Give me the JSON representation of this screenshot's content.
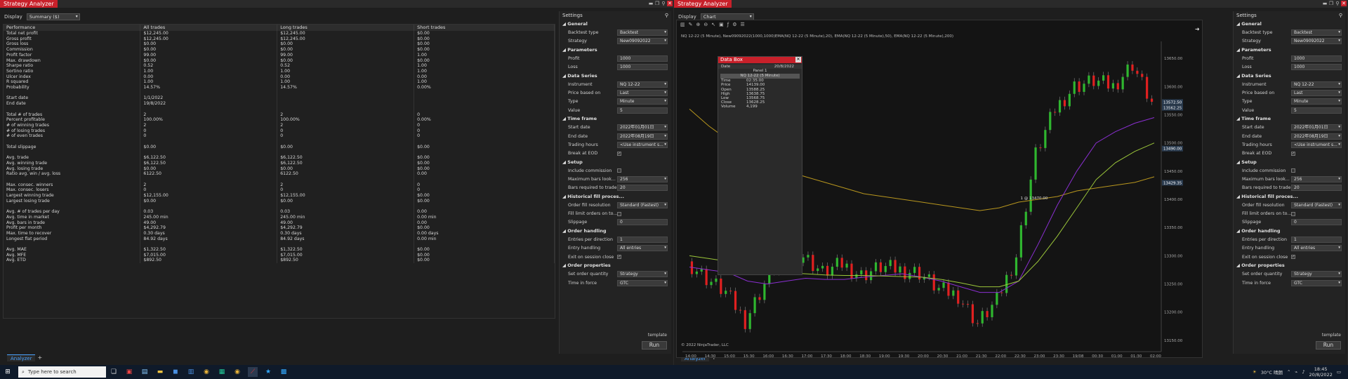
{
  "left": {
    "title": "Strategy Analyzer",
    "display_label": "Display",
    "display_value": "Summary ($)",
    "columns": [
      "Performance",
      "All trades",
      "Long trades",
      "Short trades"
    ],
    "rows": [
      [
        "Total net profit",
        "$12,245.00",
        "$12,245.00",
        "$0.00"
      ],
      [
        "Gross profit",
        "$12,245.00",
        "$12,245.00",
        "$0.00"
      ],
      [
        "Gross loss",
        "$0.00",
        "$0.00",
        "$0.00"
      ],
      [
        "Commission",
        "$0.00",
        "$0.00",
        "$0.00"
      ],
      [
        "Profit factor",
        "99.00",
        "99.00",
        "1.00"
      ],
      [
        "Max. drawdown",
        "$0.00",
        "$0.00",
        "$0.00"
      ],
      [
        "Sharpe ratio",
        "0.52",
        "0.52",
        "1.00"
      ],
      [
        "Sortino ratio",
        "1.00",
        "1.00",
        "1.00"
      ],
      [
        "Ulcer index",
        "0.00",
        "0.00",
        "0.00"
      ],
      [
        "R squared",
        "1.00",
        "1.00",
        "1.00"
      ],
      [
        "Probability",
        "14.57%",
        "14.57%",
        "0.00%"
      ],
      [
        "",
        "",
        "",
        ""
      ],
      [
        "Start date",
        "1/1/2022",
        "",
        ""
      ],
      [
        "End date",
        "19/8/2022",
        "",
        ""
      ],
      [
        "",
        "",
        "",
        ""
      ],
      [
        "Total # of trades",
        "2",
        "2",
        "0"
      ],
      [
        "Percent profitable",
        "100.00%",
        "100.00%",
        "0.00%"
      ],
      [
        "# of winning trades",
        "2",
        "2",
        "0"
      ],
      [
        "# of losing trades",
        "0",
        "0",
        "0"
      ],
      [
        "# of even trades",
        "0",
        "0",
        "0"
      ],
      [
        "",
        "",
        "",
        ""
      ],
      [
        "Total slippage",
        "$0.00",
        "$0.00",
        "$0.00"
      ],
      [
        "",
        "",
        "",
        ""
      ],
      [
        "Avg. trade",
        "$6,122.50",
        "$6,122.50",
        "$0.00"
      ],
      [
        "Avg. winning trade",
        "$6,122.50",
        "$6,122.50",
        "$0.00"
      ],
      [
        "Avg. losing trade",
        "$0.00",
        "$0.00",
        "$0.00"
      ],
      [
        "Ratio avg. win / avg. loss",
        "6122.50",
        "6122.50",
        "0.00"
      ],
      [
        "",
        "",
        "",
        ""
      ],
      [
        "Max. consec. winners",
        "2",
        "2",
        "0"
      ],
      [
        "Max. consec. losers",
        "0",
        "0",
        "0"
      ],
      [
        "Largest winning trade",
        "$12,155.00",
        "$12,155.00",
        "$0.00"
      ],
      [
        "Largest losing trade",
        "$0.00",
        "$0.00",
        "$0.00"
      ],
      [
        "",
        "",
        "",
        ""
      ],
      [
        "Avg. # of trades per day",
        "0.03",
        "0.03",
        "0.00"
      ],
      [
        "Avg. time in market",
        "245.00 min",
        "245.00 min",
        "0.00 min"
      ],
      [
        "Avg. bars in trade",
        "49.00",
        "49.00",
        "0.00"
      ],
      [
        "Profit per month",
        "$4,292.79",
        "$4,292.79",
        "$0.00"
      ],
      [
        "Max. time to recover",
        "0.30 days",
        "0.30 days",
        "0.00 days"
      ],
      [
        "Longest flat period",
        "84.92 days",
        "84.92 days",
        "0.00 min"
      ],
      [
        "",
        "",
        "",
        ""
      ],
      [
        "Avg. MAE",
        "$1,322.50",
        "$1,322.50",
        "$0.00"
      ],
      [
        "Avg. MFE",
        "$7,015.00",
        "$7,015.00",
        "$0.00"
      ],
      [
        "Avg. ETD",
        "$892.50",
        "$892.50",
        "$0.00"
      ]
    ],
    "tab": "Analyzer"
  },
  "right": {
    "title": "Strategy Analyzer",
    "display_label": "Display",
    "display_value": "Chart",
    "tab": "Analyzer",
    "series_label": "NQ 12-22 (5 Minute), New09092022(1000,1000)EMA(NQ 12-22 (5 Minute),20), EMA(NQ 12-22 (5 Minute),50), EMA(NQ 12-22 (5 Minute),200)",
    "copyright": "© 2022 NinjaTrader, LLC",
    "time_labels": [
      "14:00",
      "14:30",
      "15:00",
      "15:30",
      "16:00",
      "16:30",
      "17:00",
      "17:30",
      "18:00",
      "18:30",
      "19:00",
      "19:30",
      "20:00",
      "20:30",
      "21:00",
      "21:30",
      "22:00",
      "22:30",
      "23:00",
      "23:30",
      "19/08",
      "00:30",
      "01:00",
      "01:30",
      "02:00"
    ],
    "price_labels": [
      "13650.00",
      "13600.00",
      "13550.00",
      "13500.00",
      "13450.00",
      "13400.00",
      "13350.00",
      "13300.00",
      "13250.00",
      "13200.00",
      "13150.00"
    ],
    "price_markers": [
      "13572.50",
      "13562.25",
      "13490.00",
      "13429.35"
    ],
    "trade_label": "1 @ 13470.00",
    "databox": {
      "title": "Data Box",
      "date_label": "Date",
      "date_value": "20/8/2022",
      "panel": "Panel 1",
      "series": "NQ 12-22 (5 Minute)",
      "rows": [
        [
          "Time",
          "02:35:00"
        ],
        [
          "Price",
          "14139.00"
        ],
        [
          "Open",
          "13588.25"
        ],
        [
          "High",
          "13638.75"
        ],
        [
          "Low",
          "13568.75"
        ],
        [
          "Close",
          "13628.25"
        ],
        [
          "Volume",
          "4,199"
        ]
      ]
    }
  },
  "settings": {
    "header": "Settings",
    "sections": [
      {
        "name": "General",
        "rows": [
          [
            "Backtest type",
            "Backtest",
            "select"
          ],
          [
            "Strategy",
            "New09092022",
            "select"
          ]
        ]
      },
      {
        "name": "Parameters",
        "rows": [
          [
            "Profit",
            "1000",
            "text"
          ],
          [
            "Loss",
            "1000",
            "text"
          ]
        ]
      },
      {
        "name": "Data Series",
        "rows": [
          [
            "Instrument",
            "NQ 12-22",
            "select"
          ],
          [
            "Price based on",
            "Last",
            "select"
          ],
          [
            "Type",
            "Minute",
            "select"
          ],
          [
            "Value",
            "5",
            "text"
          ]
        ]
      },
      {
        "name": "Time frame",
        "rows": [
          [
            "Start date",
            "2022年01月01日",
            "select"
          ],
          [
            "End date",
            "2022年08月19日",
            "select"
          ],
          [
            "Trading hours",
            "<Use instrument s...",
            "select"
          ],
          [
            "Break at EOD",
            "✓",
            "check"
          ]
        ]
      },
      {
        "name": "Setup",
        "rows": [
          [
            "Include commission",
            "",
            "check"
          ],
          [
            "Maximum bars look...",
            "256",
            "select"
          ],
          [
            "Bars required to trade",
            "20",
            "text"
          ]
        ]
      },
      {
        "name": "Historical fill proces...",
        "rows": [
          [
            "Order fill resolution",
            "Standard (Fastest)",
            "select"
          ],
          [
            "Fill limit orders on to...",
            "",
            "check"
          ],
          [
            "Slippage",
            "0",
            "text"
          ]
        ]
      },
      {
        "name": "Order handling",
        "rows": [
          [
            "Entries per direction",
            "1",
            "text"
          ],
          [
            "Entry handling",
            "All entries",
            "select"
          ],
          [
            "Exit on session close",
            "✓",
            "check"
          ]
        ]
      },
      {
        "name": "Order properties",
        "rows": [
          [
            "Set order quantity",
            "Strategy",
            "select"
          ],
          [
            "Time in force",
            "GTC",
            "select"
          ]
        ]
      }
    ],
    "template": "template",
    "run": "Run"
  },
  "taskbar": {
    "search_placeholder": "Type here to search",
    "weather": "30°C 晴朗",
    "time": "18:45",
    "date": "20/8/2022"
  },
  "chart_data": {
    "type": "line",
    "title": "",
    "xlabel": "",
    "ylabel": "",
    "ylim": [
      13130,
      13680
    ],
    "categories": [
      "14:00",
      "14:30",
      "15:00",
      "15:30",
      "16:00",
      "16:30",
      "17:00",
      "17:30",
      "18:00",
      "18:30",
      "19:00",
      "19:30",
      "20:00",
      "20:30",
      "21:00",
      "21:30",
      "22:00",
      "22:30",
      "23:00",
      "23:30",
      "19/08",
      "00:30",
      "01:00",
      "01:30",
      "02:00"
    ],
    "series": [
      {
        "values": [
          13290,
          13260,
          13235,
          13185,
          13250,
          13310,
          13300,
          13270,
          13285,
          13265,
          13280,
          13275,
          13270,
          13240,
          13230,
          13180,
          13220,
          13300,
          13480,
          13560,
          13600,
          13610,
          13600,
          13640,
          13570
        ]
      },
      {
        "values": [
          13560,
          13530,
          13505,
          13480,
          13465,
          13450,
          13440,
          13430,
          13420,
          13410,
          13405,
          13400,
          13395,
          13390,
          13385,
          13380,
          13385,
          13395,
          13400,
          13405,
          13415,
          13420,
          13425,
          13430,
          13440
        ]
      },
      {
        "values": [
          13280,
          13275,
          13270,
          13255,
          13250,
          13255,
          13260,
          13258,
          13258,
          13262,
          13265,
          13268,
          13262,
          13255,
          13245,
          13235,
          13235,
          13255,
          13320,
          13390,
          13450,
          13500,
          13520,
          13535,
          13545
        ]
      },
      {
        "values": [
          13300,
          13295,
          13290,
          13280,
          13272,
          13270,
          13268,
          13266,
          13265,
          13265,
          13264,
          13263,
          13262,
          13258,
          13252,
          13245,
          13245,
          13255,
          13290,
          13335,
          13385,
          13435,
          13465,
          13485,
          13500
        ]
      }
    ]
  }
}
